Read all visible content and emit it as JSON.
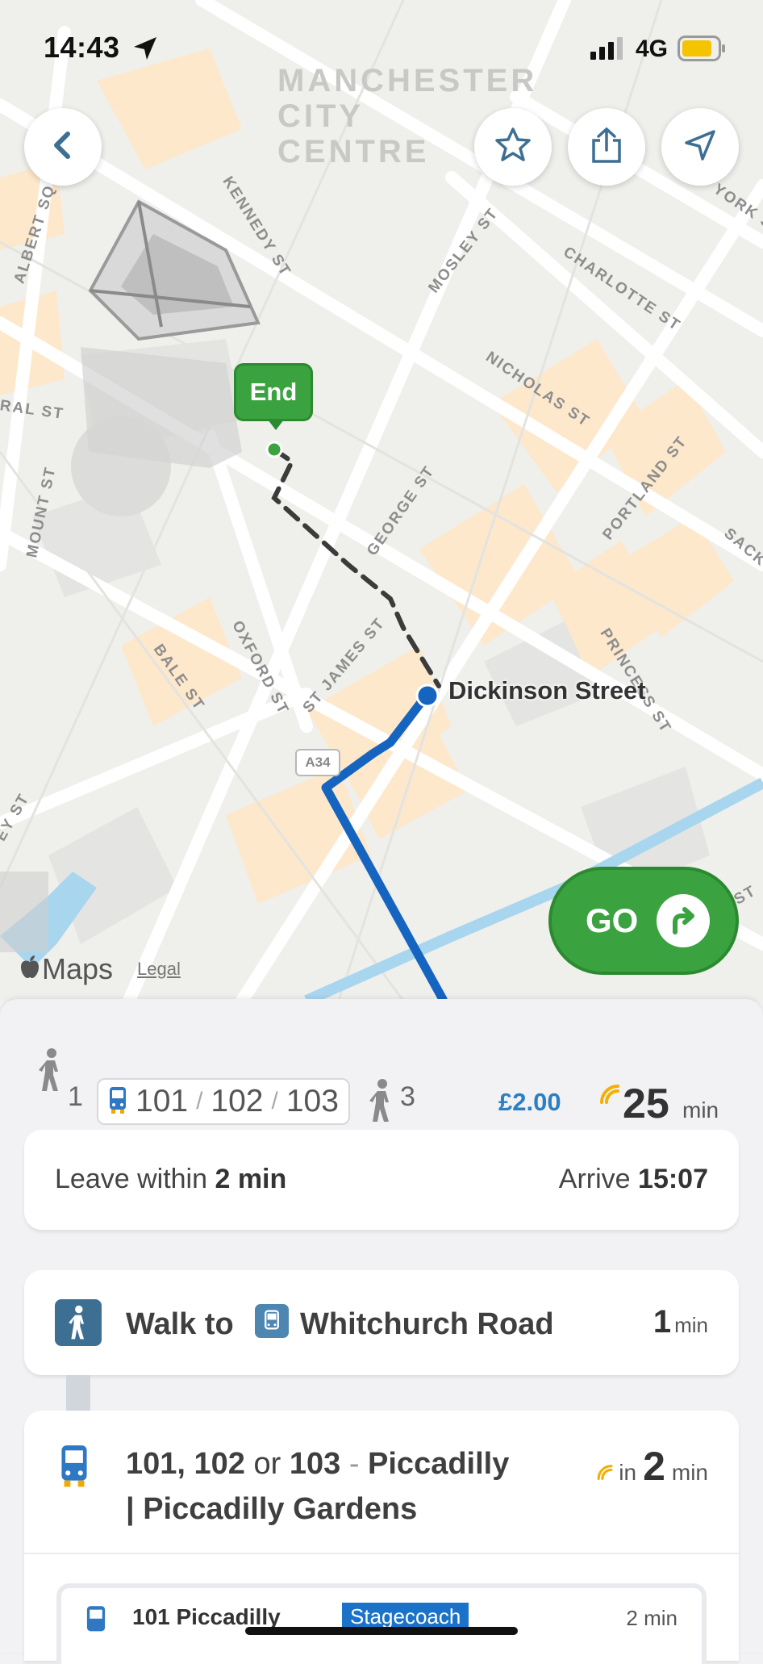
{
  "status_bar": {
    "time": "14:43",
    "network": "4G"
  },
  "map": {
    "district": "MANCHESTER CITY CENTRE",
    "streets": [
      "KENNEDY ST",
      "MOSLEY ST",
      "CHARLOTTE ST",
      "YORK ST",
      "ALBERT SQ",
      "NICHOLAS ST",
      "PORTLAND ST",
      "RAL ST",
      "MOUNT ST",
      "GEORGE ST",
      "SACK",
      "OXFORD ST",
      "BALE ST",
      "ST JAMES ST",
      "PRINCESS ST",
      "EY ST",
      "ST"
    ],
    "road_shield": "A34",
    "end_label": "End",
    "stop_label": "Dickinson Street",
    "go_label": "GO",
    "maps_brand": "Maps",
    "legal": "Legal",
    "route_color": "#1565c0",
    "accent_green": "#3aa23f"
  },
  "summary": {
    "walk_before": "1",
    "routes": [
      "101",
      "102",
      "103"
    ],
    "walk_after": "3",
    "price": "£2.00",
    "duration": "25",
    "duration_unit": "min"
  },
  "timing": {
    "leave_prefix": "Leave within",
    "leave_value": "2 min",
    "arrive_prefix": "Arrive",
    "arrive_value": "15:07"
  },
  "walk_step": {
    "label": "Walk to",
    "stop": "Whitchurch Road",
    "time": "1",
    "unit": "min"
  },
  "bus_step": {
    "routes_a": "101, 102",
    "or": "or",
    "routes_b": "103",
    "dash": "-",
    "dest_line1": "Piccadilly",
    "dest_line2": "| Piccadilly Gardens",
    "due_prefix": "in",
    "due_value": "2",
    "due_unit": "min",
    "sub_route": "101  Piccadilly",
    "operator": "Stagecoach",
    "sub_time": "2 min"
  }
}
